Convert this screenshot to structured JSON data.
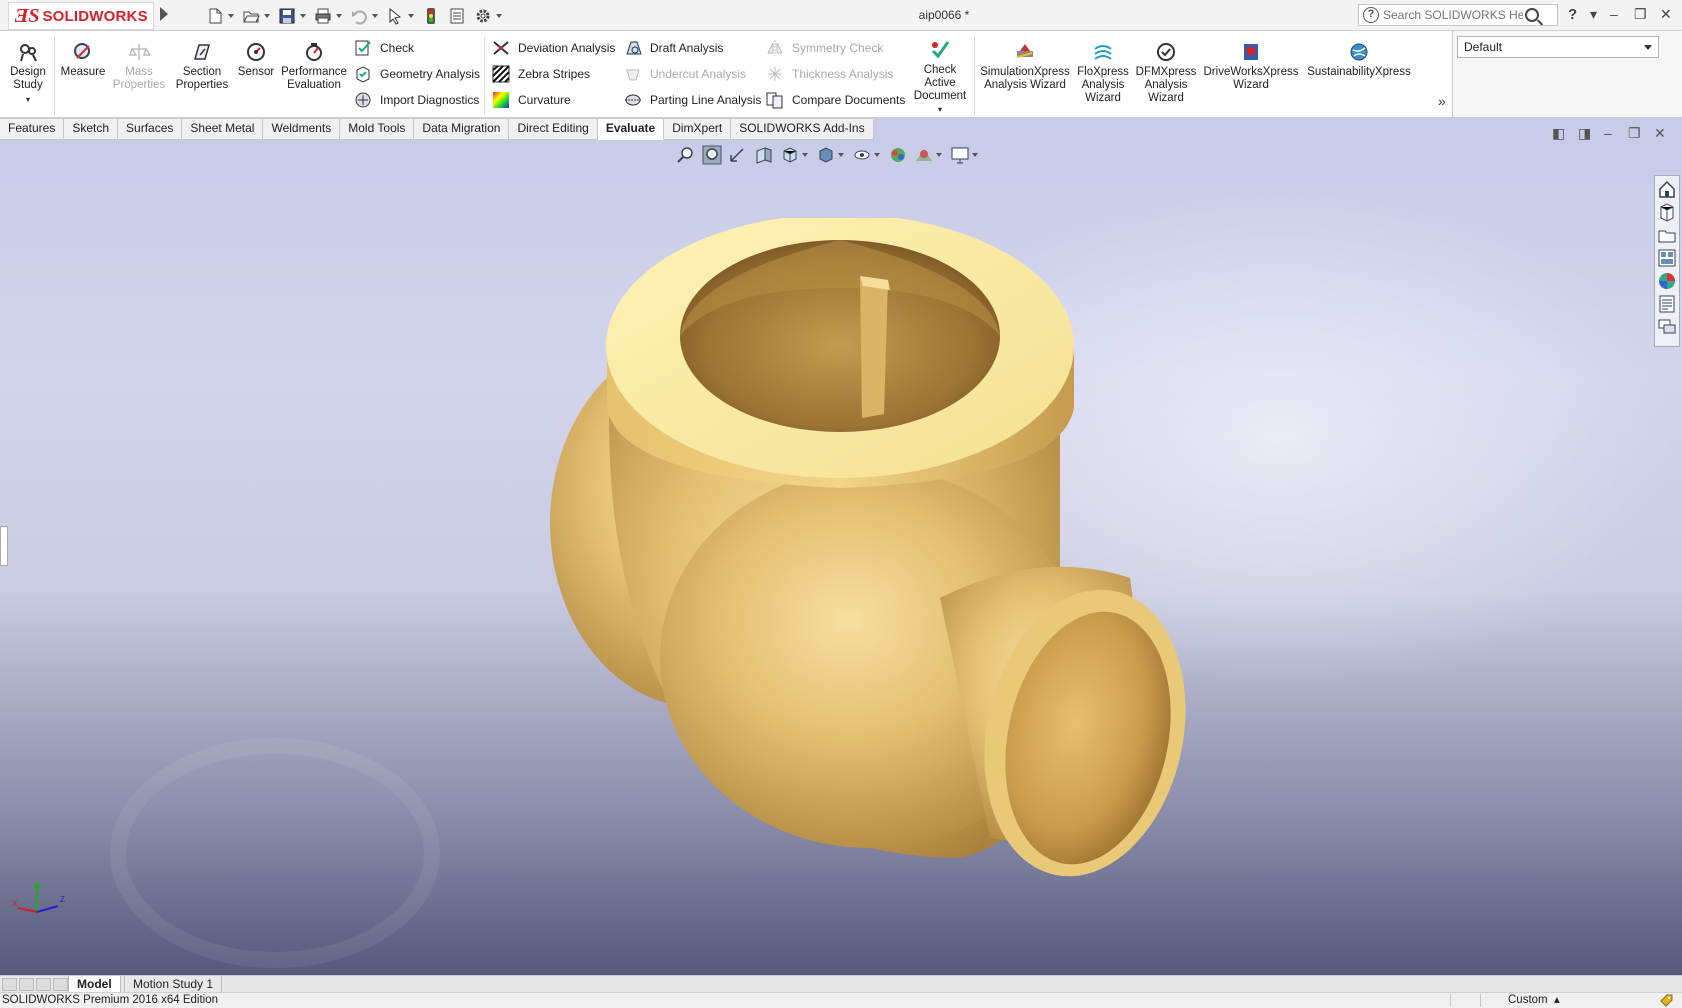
{
  "app": {
    "logo_text": "SOLIDWORKS",
    "document_title": "aip0066 *",
    "search_placeholder": "Search SOLIDWORKS Help",
    "help_label": "?"
  },
  "ribbon": {
    "big_buttons": [
      {
        "label": "Design Study",
        "icon": "design-study-icon",
        "enabled": true
      },
      {
        "label": "Measure",
        "icon": "measure-icon",
        "enabled": true
      },
      {
        "label": "Mass Properties",
        "icon": "mass-properties-icon",
        "enabled": false
      },
      {
        "label": "Section Properties",
        "icon": "section-properties-icon",
        "enabled": true
      },
      {
        "label": "Sensor",
        "icon": "sensor-icon",
        "enabled": true
      },
      {
        "label": "Performance Evaluation",
        "icon": "performance-evaluation-icon",
        "enabled": true
      }
    ],
    "col1": [
      {
        "label": "Check",
        "icon": "check-icon",
        "enabled": true
      },
      {
        "label": "Geometry Analysis",
        "icon": "geometry-analysis-icon",
        "enabled": true
      },
      {
        "label": "Import Diagnostics",
        "icon": "import-diagnostics-icon",
        "enabled": true
      }
    ],
    "col2": [
      {
        "label": "Deviation Analysis",
        "icon": "deviation-analysis-icon",
        "enabled": true
      },
      {
        "label": "Zebra Stripes",
        "icon": "zebra-stripes-icon",
        "enabled": true
      },
      {
        "label": "Curvature",
        "icon": "curvature-icon",
        "enabled": true
      }
    ],
    "col3": [
      {
        "label": "Draft Analysis",
        "icon": "draft-analysis-icon",
        "enabled": true
      },
      {
        "label": "Undercut Analysis",
        "icon": "undercut-analysis-icon",
        "enabled": false
      },
      {
        "label": "Parting Line Analysis",
        "icon": "parting-line-analysis-icon",
        "enabled": true
      }
    ],
    "col4": [
      {
        "label": "Symmetry Check",
        "icon": "symmetry-check-icon",
        "enabled": false
      },
      {
        "label": "Thickness Analysis",
        "icon": "thickness-analysis-icon",
        "enabled": false
      },
      {
        "label": "Compare Documents",
        "icon": "compare-documents-icon",
        "enabled": true
      }
    ],
    "check_active": {
      "label": "Check Active Document",
      "icon": "check-active-document-icon"
    },
    "xpress": [
      {
        "label": "SimulationXpress Analysis Wizard",
        "icon": "simulationxpress-icon"
      },
      {
        "label": "FloXpress Analysis Wizard",
        "icon": "floxpress-icon"
      },
      {
        "label": "DFMXpress Analysis Wizard",
        "icon": "dfmxpress-icon"
      },
      {
        "label": "DriveWorksXpress Wizard",
        "icon": "driveworksxpress-icon"
      },
      {
        "label": "SustainabilityXpress",
        "icon": "sustainabilityxpress-icon"
      }
    ],
    "configuration": "Default"
  },
  "tabs": [
    "Features",
    "Sketch",
    "Surfaces",
    "Sheet Metal",
    "Weldments",
    "Mold Tools",
    "Data Migration",
    "Direct Editing",
    "Evaluate",
    "DimXpert",
    "SOLIDWORKS Add-Ins"
  ],
  "active_tab": "Evaluate",
  "bottom_tabs": [
    "Model",
    "Motion Study 1"
  ],
  "active_bottom_tab": "Model",
  "status": {
    "edition": "SOLIDWORKS Premium 2016 x64 Edition",
    "units": "Custom"
  },
  "colors": {
    "brand_red": "#d8202a",
    "part_gold": "#e6c46f"
  }
}
